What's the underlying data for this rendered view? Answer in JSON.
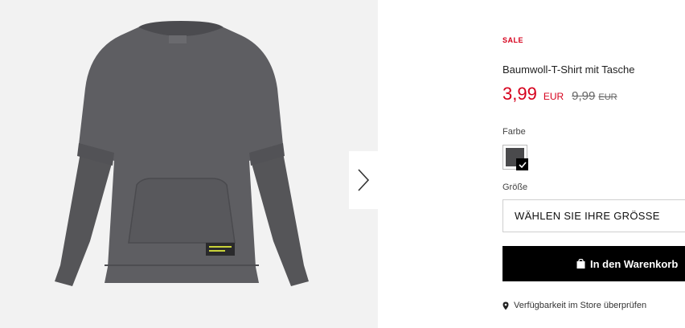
{
  "product": {
    "sale_label": "SALE",
    "title": "Baumwoll-T-Shirt mit Tasche",
    "price_current": "3,99",
    "price_currency": "EUR",
    "price_old": "9,99",
    "price_old_currency": "EUR",
    "image_alt_logo": "RESERVED"
  },
  "color": {
    "label": "Farbe",
    "selected_swatch": "#4a4a4c"
  },
  "size": {
    "label": "Größe",
    "placeholder": "WÄHLEN SIE IHRE GRÖSSE"
  },
  "cart": {
    "button_label": "In den Warenkorb",
    "icon": "shopping-bag-icon"
  },
  "store": {
    "link_label": "Verfügbarkeit im Store überprüfen",
    "icon": "location-pin-icon"
  },
  "gallery": {
    "next_icon": "chevron-right-icon"
  }
}
